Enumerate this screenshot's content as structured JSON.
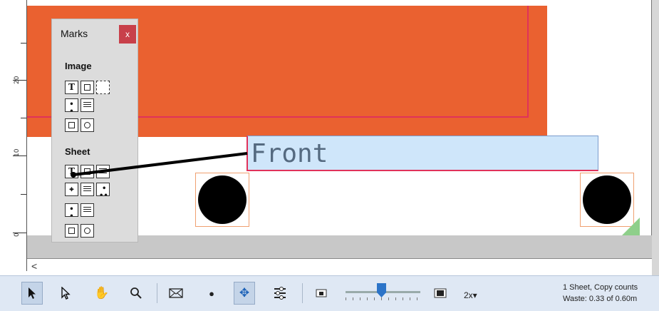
{
  "ruler": {
    "labels": [
      "20",
      "10",
      "0"
    ]
  },
  "marks_palette": {
    "title": "Marks",
    "close_label": "x",
    "section_image": "Image",
    "section_sheet": "Sheet",
    "image_buttons": [
      "text-mark",
      "page-mark",
      "crop-mark",
      "registration-mark",
      "lines-mark",
      "rectangle-mark",
      "circle-mark"
    ],
    "sheet_buttons": [
      "text-mark",
      "page-mark",
      "fold-mark",
      "target-mark",
      "lines-mark",
      "dots-mark",
      "registration-mark",
      "lines-mark",
      "rectangle-mark",
      "circle-mark"
    ],
    "text_glyph": "T"
  },
  "canvas": {
    "front_text": "Front",
    "colors": {
      "background_art": "#ea6130",
      "bleed_line": "#e0325a",
      "selected_mark": "#cfe6fa"
    }
  },
  "scrollbar": {
    "left_arrow": "<"
  },
  "toolbar": {
    "zoom": "2x▾",
    "status_line1": "1 Sheet, Copy counts",
    "status_line2": "Waste: 0.33 of 0.60m"
  }
}
